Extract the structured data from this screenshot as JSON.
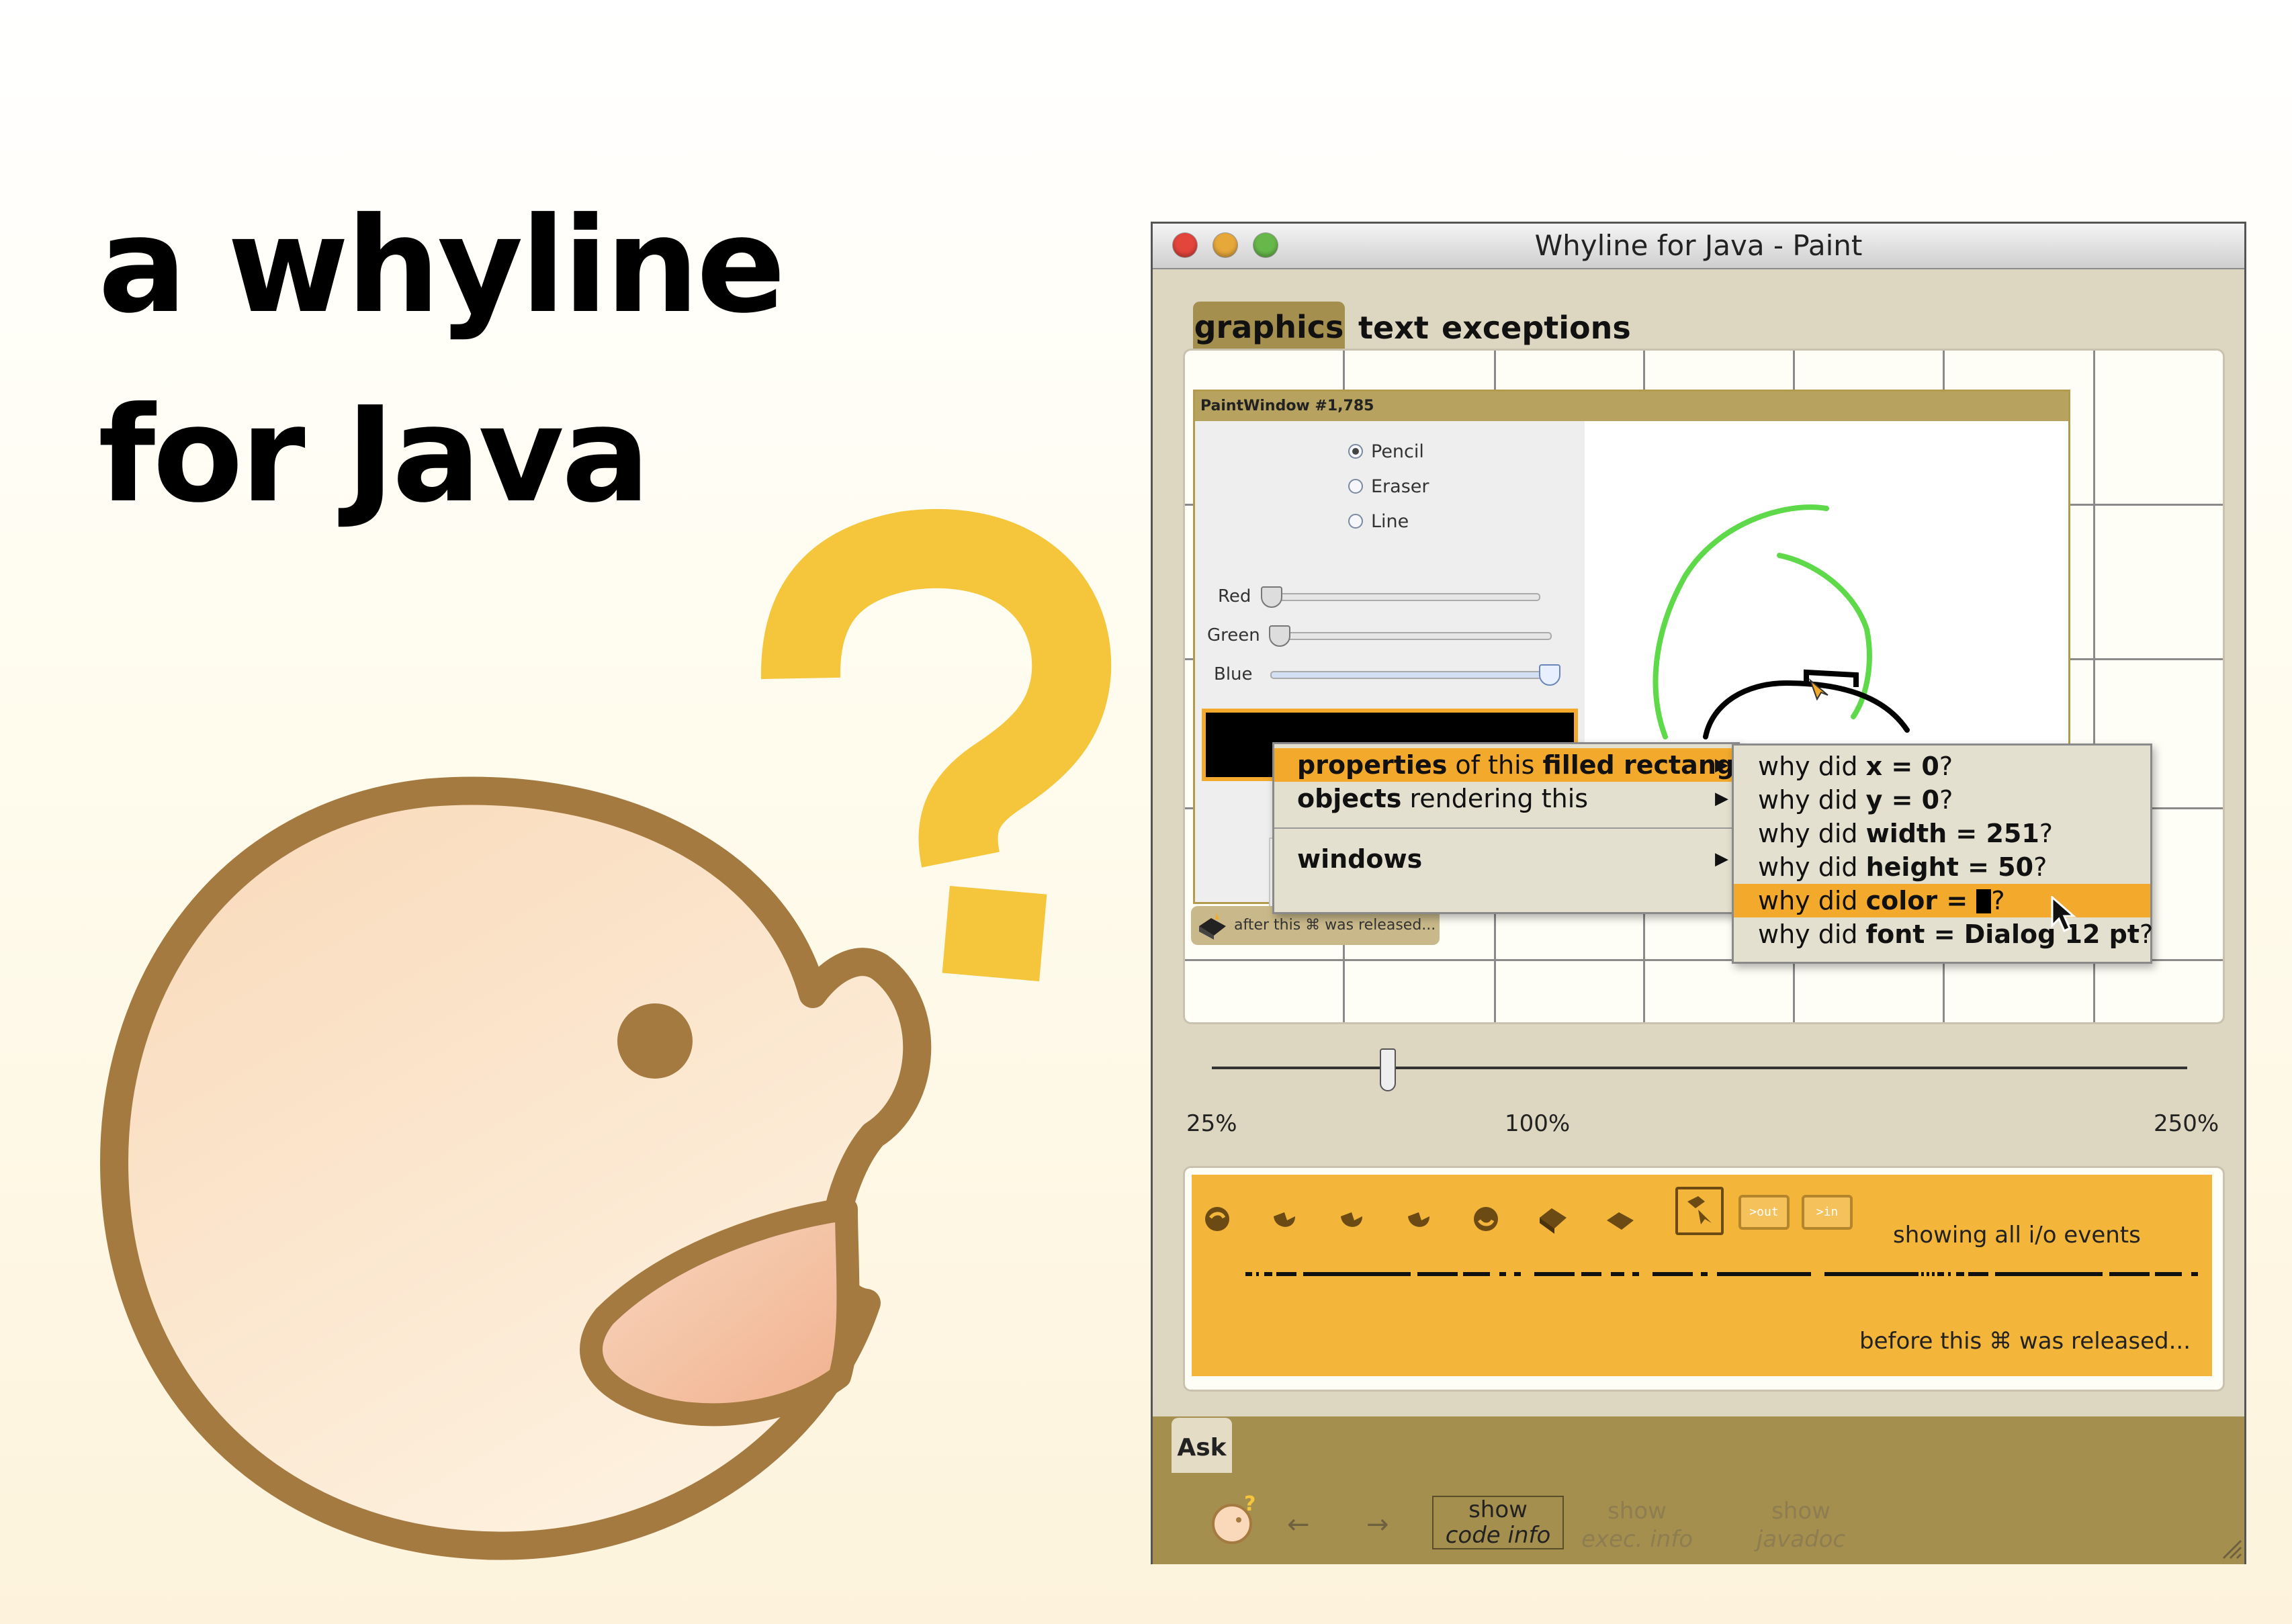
{
  "slide": {
    "title": "a whyline for Java"
  },
  "window": {
    "title": "Whyline for Java - Paint",
    "tabs": [
      "graphics",
      "text",
      "exceptions"
    ]
  },
  "paint_window": {
    "header": "PaintWindow #1,785",
    "tools": [
      "Pencil",
      "Eraser",
      "Line"
    ],
    "selected_tool": "Pencil",
    "sliders": [
      "Red",
      "Green",
      "Blue"
    ],
    "after_event_label": "after this ⌘ was released..."
  },
  "context_menu": {
    "items": [
      {
        "bold": "properties",
        "normal": " of this ",
        "bold2": "filled rectangle"
      },
      {
        "bold": "objects",
        "normal": " rendering this",
        "bold2": ""
      },
      {
        "bold": "windows",
        "normal": "",
        "bold2": ""
      }
    ]
  },
  "submenu": {
    "items": [
      {
        "pre": "why did ",
        "bold": "x = 0",
        "post": "?"
      },
      {
        "pre": "why did ",
        "bold": "y = 0",
        "post": "?"
      },
      {
        "pre": "why did ",
        "bold": "width = 251",
        "post": "?"
      },
      {
        "pre": "why did ",
        "bold": "height = 50",
        "post": "?"
      },
      {
        "pre": "why did ",
        "bold": "color = ",
        "post": "?"
      },
      {
        "pre": "why did ",
        "bold": "font = Dialog 12 pt",
        "post": "?"
      }
    ],
    "highlighted_index": 4
  },
  "zoom": {
    "min_label": "25%",
    "mid_label": "100%",
    "max_label": "250%"
  },
  "timeline": {
    "showing_label": "showing all i/o events",
    "before_label": "before this ⌘ was released...",
    "out_label": ">out",
    "in_label": ">in"
  },
  "bottom_bar": {
    "ask_tab": "Ask",
    "back_arrow": "←",
    "forward_arrow": "→",
    "btn_code": {
      "line1": "show",
      "line2": "code info"
    },
    "btn_exec": {
      "line1": "show",
      "line2": "exec. info"
    },
    "btn_javadoc": {
      "line1": "show",
      "line2": "javadoc"
    }
  },
  "colors": {
    "accent_orange": "#f3aa2c",
    "question_mark_yellow": "#f5c63c",
    "face_outline": "#a47a41",
    "window_bg": "#ddd6c0",
    "bottom_bar": "#a58f4e"
  },
  "icons": [
    "question-mark-icon",
    "face-illustration",
    "close-light-icon",
    "minimize-light-icon",
    "zoom-light-icon",
    "cursor-icon",
    "whyline-logo-icon"
  ]
}
